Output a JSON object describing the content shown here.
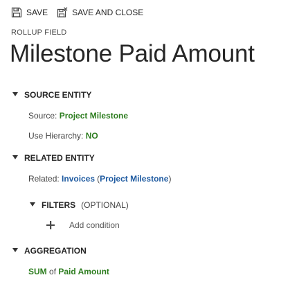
{
  "toolbar": {
    "save_label": "SAVE",
    "save_and_close_label": "SAVE AND CLOSE",
    "save_icon": "save-icon",
    "save_and_close_icon": "save-and-close-icon"
  },
  "header": {
    "form_type": "ROLLUP FIELD",
    "title": "Milestone Paid Amount"
  },
  "source_entity": {
    "heading": "SOURCE ENTITY",
    "source_label": "Source:",
    "source_value": "Project Milestone",
    "hierarchy_label": "Use Hierarchy:",
    "hierarchy_value": "NO"
  },
  "related_entity": {
    "heading": "RELATED ENTITY",
    "related_label": "Related:",
    "related_value": "Invoices",
    "related_via": "Project Milestone",
    "open_paren": "(",
    "close_paren": ")"
  },
  "filters": {
    "heading": "FILTERS",
    "optional": "(OPTIONAL)",
    "add_condition": "Add condition"
  },
  "aggregation": {
    "heading": "AGGREGATION",
    "function": "SUM",
    "connector": "of",
    "field": "Paid Amount"
  },
  "colors": {
    "green_value": "#2d7d1f",
    "link_blue": "#1e5aa0",
    "text": "#262626"
  }
}
